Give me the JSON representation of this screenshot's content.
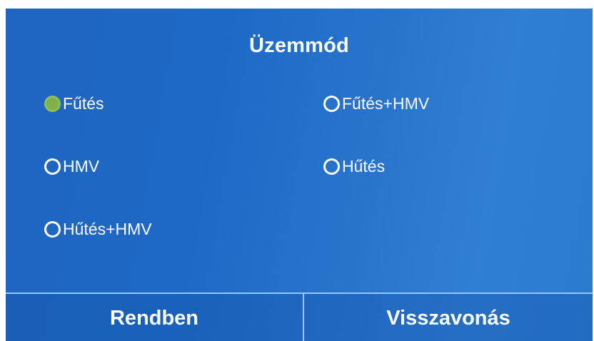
{
  "title": "Üzemmód",
  "options": [
    {
      "label": "Fűtés",
      "selected": true
    },
    {
      "label": "Fűtés+HMV",
      "selected": false
    },
    {
      "label": "HMV",
      "selected": false
    },
    {
      "label": "Hűtés",
      "selected": false
    },
    {
      "label": "Hűtés+HMV",
      "selected": false
    }
  ],
  "buttons": {
    "ok_label": "Rendben",
    "cancel_label": "Visszavonás"
  },
  "colors": {
    "background": "#1f64c0",
    "selected_radio": "#7fb04a",
    "text": "#ffffff"
  }
}
